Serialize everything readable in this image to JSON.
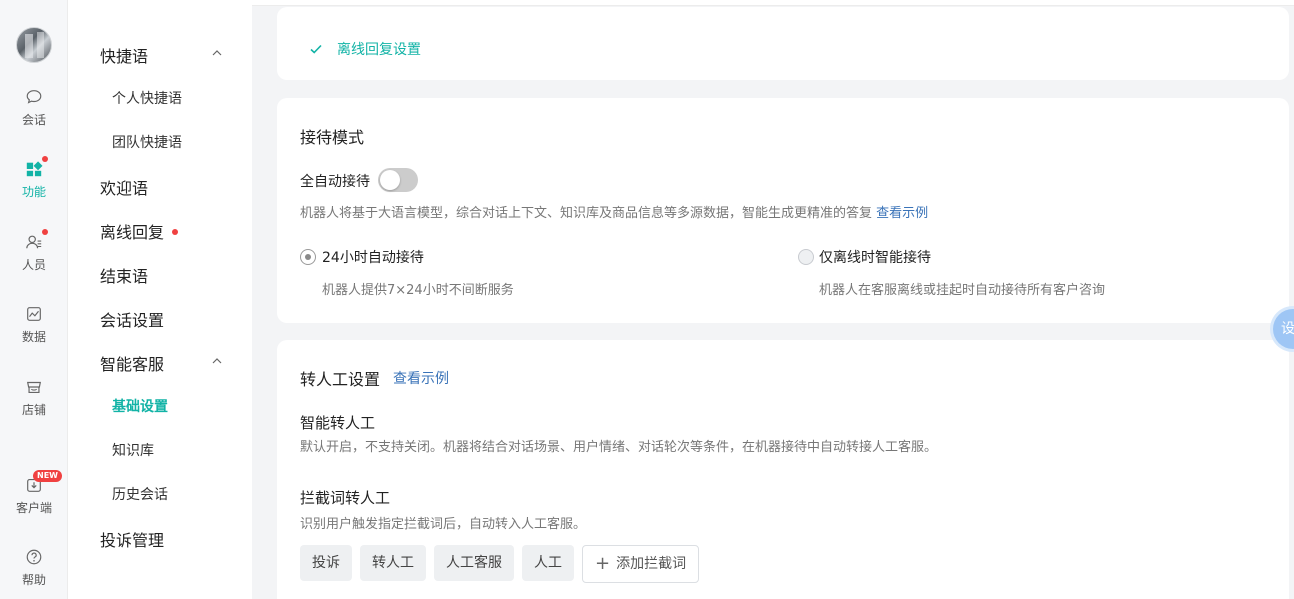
{
  "rail": {
    "items": [
      {
        "label": "会话",
        "icon": "chat-bubble-icon"
      },
      {
        "label": "功能",
        "icon": "grid-apps-icon"
      },
      {
        "label": "人员",
        "icon": "users-icon"
      },
      {
        "label": "数据",
        "icon": "chart-icon"
      },
      {
        "label": "店铺",
        "icon": "store-icon"
      },
      {
        "label": "客户端",
        "icon": "download-icon"
      },
      {
        "label": "帮助",
        "icon": "help-icon"
      }
    ],
    "new_badge": "NEW",
    "accent": "#12b3a6"
  },
  "subnav": {
    "quick_phrases": "快捷语",
    "personal_phrases": "个人快捷语",
    "team_phrases": "团队快捷语",
    "welcome": "欢迎语",
    "offline_reply": "离线回复",
    "closing": "结束语",
    "session_settings": "会话设置",
    "smart_service": "智能客服",
    "basic_settings": "基础设置",
    "knowledge_base": "知识库",
    "history_sessions": "历史会话",
    "complaints": "投诉管理"
  },
  "offline_card": {
    "item": "离线回复设置"
  },
  "reception": {
    "title": "接待模式",
    "auto_label": "全自动接待",
    "auto_enabled": false,
    "auto_desc": "机器人将基于大语言模型，综合对话上下文、知识库及商品信息等多源数据，智能生成更精准的答复",
    "example_link": "查看示例",
    "option_24h": "24小时自动接待",
    "option_24h_desc": "机器人提供7×24小时不间断服务",
    "option_offline": "仅离线时智能接待",
    "option_offline_desc": "机器人在客服离线或挂起时自动接待所有客户咨询",
    "selected": "24h"
  },
  "transfer": {
    "title": "转人工设置",
    "example_link": "查看示例",
    "smart_title": "智能转人工",
    "smart_desc": "默认开启，不支持关闭。机器将结合对话场景、用户情绪、对话轮次等条件，在机器接待中自动转接人工客服。",
    "keyword_title": "拦截词转人工",
    "keyword_desc": "识别用户触发指定拦截词后，自动转入人工客服。",
    "keywords": [
      "投诉",
      "转人工",
      "人工客服",
      "人工"
    ],
    "add_keyword": "添加拦截词"
  },
  "float_button": {
    "label": "设"
  }
}
